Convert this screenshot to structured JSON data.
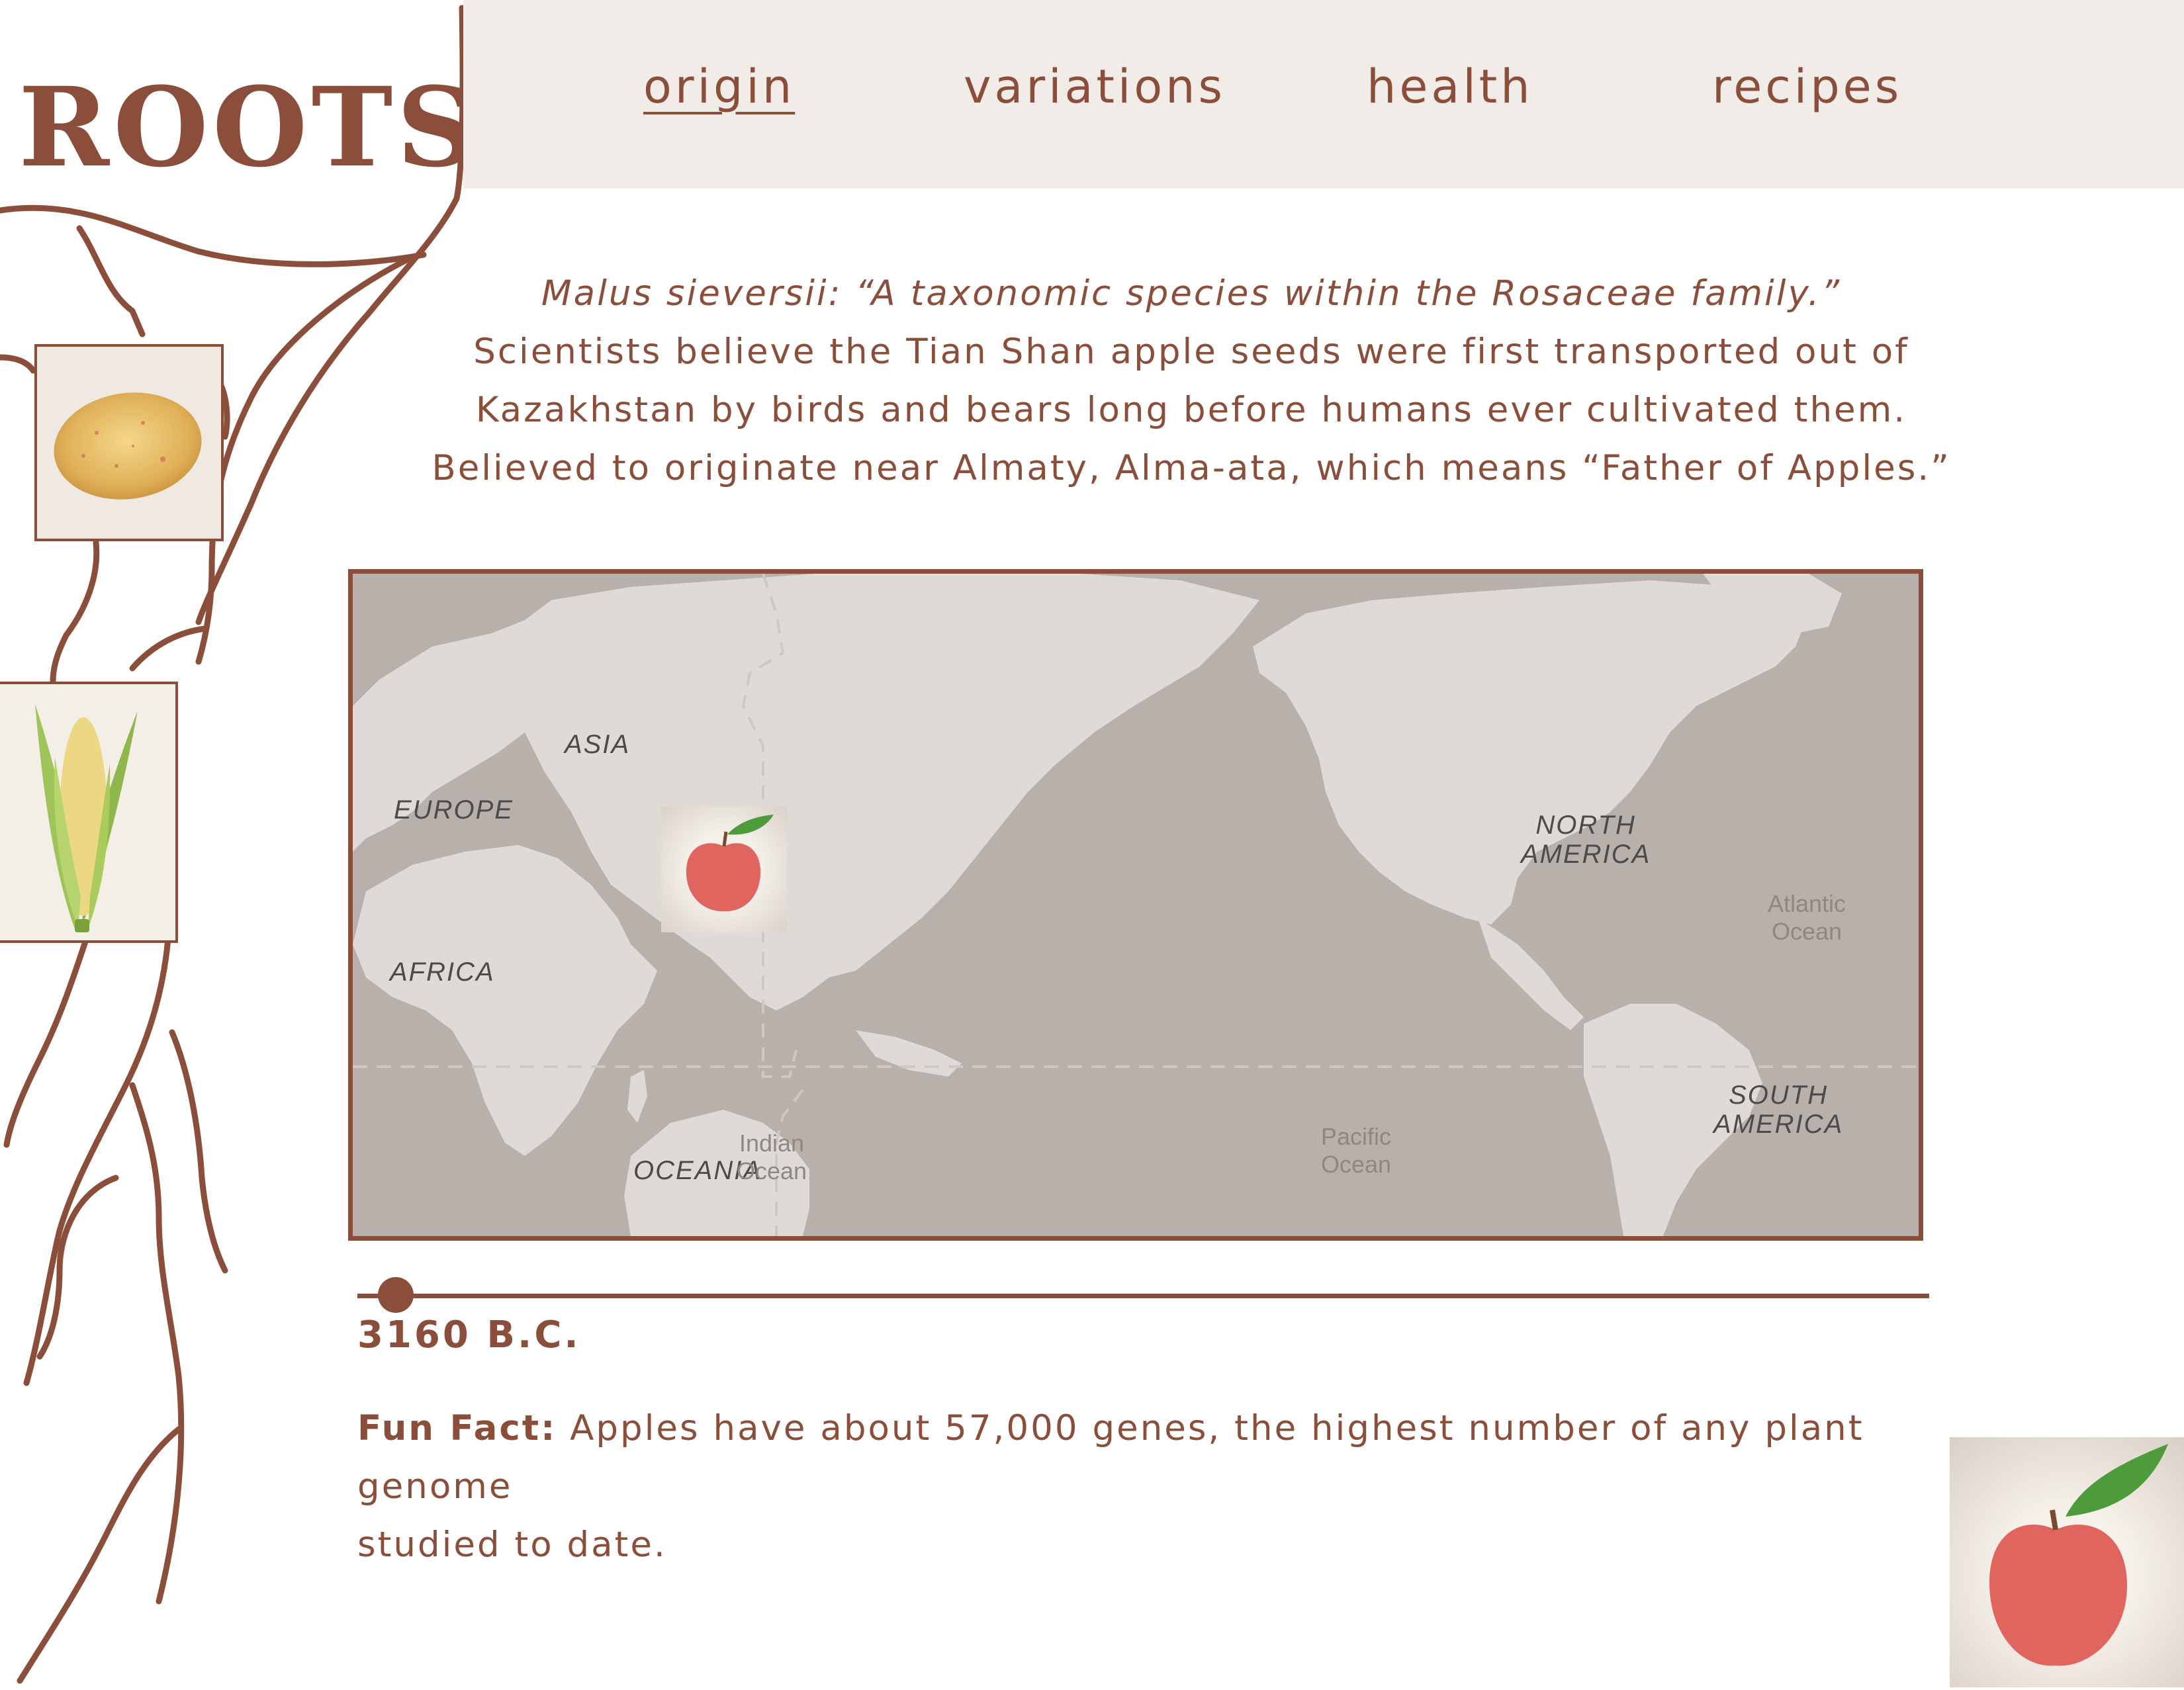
{
  "brand": {
    "logo_text": "ROOTS"
  },
  "nav": {
    "items": [
      {
        "label": "origin",
        "active": true
      },
      {
        "label": "variations",
        "active": false
      },
      {
        "label": "health",
        "active": false
      },
      {
        "label": "recipes",
        "active": false
      }
    ]
  },
  "intro": {
    "scientific_line": "Malus sieversii: “A taxonomic species within the Rosaceae family.”",
    "line1": "Scientists believe the Tian Shan apple seeds were first transported out of",
    "line2": "Kazakhstan by birds and bears long before humans ever cultivated them.",
    "line3": "Believed to originate near Almaty, Alma-ata, which means “Father of Apples.”"
  },
  "map": {
    "continents": {
      "asia": "ASIA",
      "europe": "EUROPE",
      "africa": "AFRICA",
      "north_america": [
        "NORTH",
        "AMERICA"
      ],
      "south_america": [
        "SOUTH",
        "AMERICA"
      ],
      "oceania": "OCEANIA"
    },
    "oceans": {
      "atlantic": [
        "Atlantic",
        "Ocean"
      ],
      "indian": [
        "Indian",
        "Ocean"
      ],
      "pacific": [
        "Pacific",
        "Ocean"
      ]
    },
    "marker_icon": "apple-icon"
  },
  "timeline": {
    "year": "3160 B.C.",
    "progress": 0.02
  },
  "fun_fact": {
    "label": "Fun Fact:",
    "text": "Apples have about 57,000 genes, the highest number of any plant genome",
    "text2": "studied to date."
  },
  "icons": [
    "potato-icon",
    "corn-icon",
    "apple-icon"
  ],
  "colors": {
    "brand_brown": "#8a4e3b",
    "nav_background": "#f1ece8",
    "map_ocean": "#b8b0ab",
    "map_land": "#e0dad6"
  }
}
